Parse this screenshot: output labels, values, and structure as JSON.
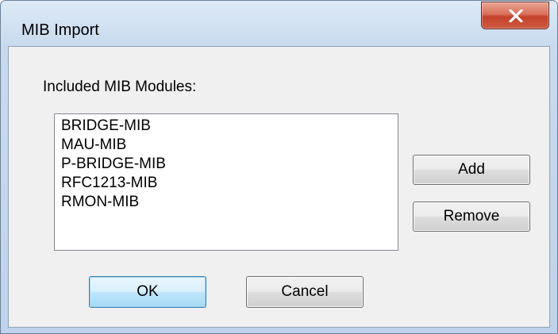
{
  "window": {
    "title": "MIB Import",
    "close_glyph": "X"
  },
  "dialog": {
    "modules_label": "Included MIB Modules:",
    "modules": [
      "BRIDGE-MIB",
      "MAU-MIB",
      "P-BRIDGE-MIB",
      "RFC1213-MIB",
      "RMON-MIB"
    ],
    "add_label": "Add",
    "remove_label": "Remove",
    "ok_label": "OK",
    "cancel_label": "Cancel"
  },
  "icons": {
    "close": "close-icon"
  },
  "colors": {
    "close_button": "#c3422b",
    "default_button_border": "#3c7fb1",
    "dialog_background": "#f0f0f0",
    "title_bar": "#c7daee"
  }
}
